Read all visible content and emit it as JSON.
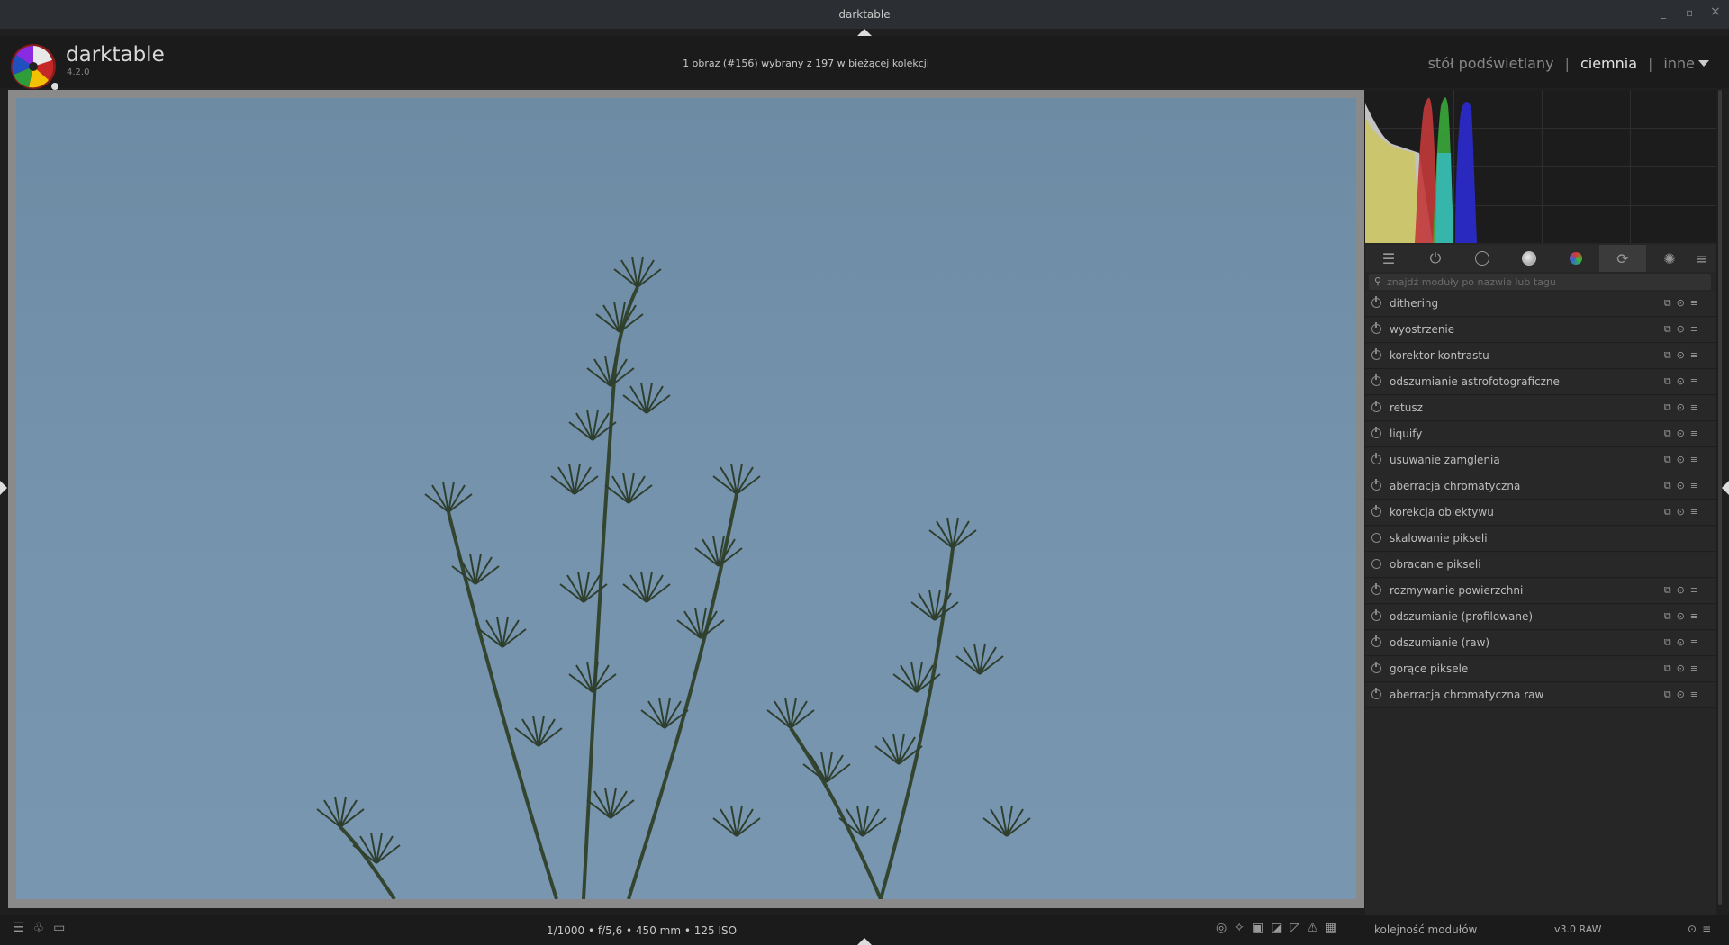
{
  "window": {
    "title": "darktable",
    "minimize": "_",
    "maximize": "▫",
    "close": "×"
  },
  "brand": {
    "name": "darktable",
    "version": "4.2.0"
  },
  "header": {
    "selection_info": "1 obraz (#156) wybrany z 197 w bieżącej kolekcji",
    "views": {
      "lighttable": "stół podświetlany",
      "darkroom": "ciemnia",
      "other": "inne",
      "separator": "|"
    }
  },
  "search": {
    "placeholder": "znajdź moduły po nazwie lub tagu"
  },
  "modules": [
    {
      "name": "dithering",
      "power": "on",
      "actions": true
    },
    {
      "name": "wyostrzenie",
      "power": "on",
      "actions": true
    },
    {
      "name": "korektor kontrastu",
      "power": "on",
      "actions": true
    },
    {
      "name": "odszumianie astrofotograficzne",
      "power": "on",
      "actions": true
    },
    {
      "name": "retusz",
      "power": "on",
      "actions": true
    },
    {
      "name": "liquify",
      "power": "on",
      "actions": true
    },
    {
      "name": "usuwanie zamglenia",
      "power": "on",
      "actions": true
    },
    {
      "name": "aberracja chromatyczna",
      "power": "on",
      "actions": true
    },
    {
      "name": "korekcja obiektywu",
      "power": "on",
      "actions": true
    },
    {
      "name": "skalowanie pikseli",
      "power": "off",
      "actions": false
    },
    {
      "name": "obracanie pikseli",
      "power": "off",
      "actions": false
    },
    {
      "name": "rozmywanie powierzchni",
      "power": "on",
      "actions": true
    },
    {
      "name": "odszumianie (profilowane)",
      "power": "on",
      "actions": true
    },
    {
      "name": "odszumianie (raw)",
      "power": "on",
      "actions": true
    },
    {
      "name": "gorące piksele",
      "power": "on",
      "actions": true
    },
    {
      "name": "aberracja chromatyczna raw",
      "power": "on",
      "actions": true
    }
  ],
  "bottom": {
    "exif": "1/1000 • f/5,6 • 450 mm • 125 ISO",
    "module_order_label": "kolejność modułów",
    "module_order_value": "v3.0 RAW"
  },
  "icons": {
    "group_tabs": [
      "sliders-icon",
      "power-icon",
      "circle-icon",
      "filled-circle-icon",
      "color-ball-icon",
      "refresh-icon",
      "aperture-icon",
      "menu-icon"
    ],
    "bottom_left": [
      "menu-icon",
      "styles-icon",
      "display-icon"
    ],
    "bottom_tools": [
      "focus-peaking-icon",
      "bulb-icon",
      "soft-proof-icon",
      "gamut-check-icon",
      "clipping-icon",
      "warning-icon",
      "grid-icon"
    ]
  }
}
